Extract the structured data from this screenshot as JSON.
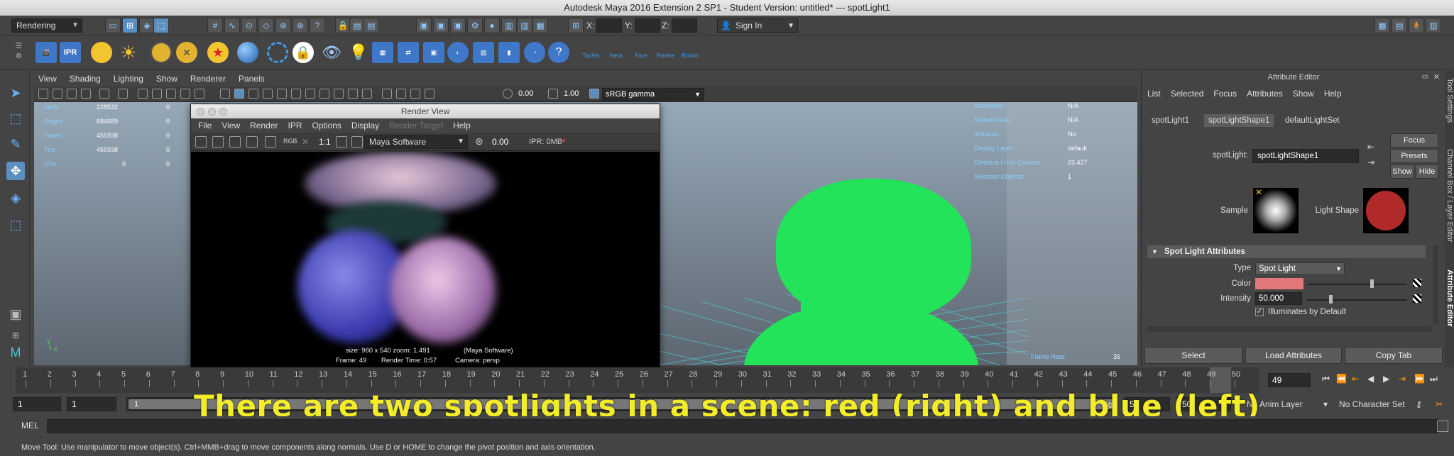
{
  "window": {
    "title": "Autodesk Maya 2016 Extension 2 SP1 - Student Version: untitled*   ---   spotLight1"
  },
  "status_line": {
    "menuset": "Rendering",
    "x_label": "X:",
    "y_label": "Y:",
    "z_label": "Z:",
    "sign_in": "Sign In"
  },
  "shelf": {
    "ipr_label": "IPR",
    "rig_labels": [
      "TopHe:",
      "Neck",
      "Face",
      "Forehe",
      "Botton"
    ]
  },
  "viewport": {
    "menus": [
      "View",
      "Shading",
      "Lighting",
      "Show",
      "Renderer",
      "Panels"
    ],
    "exposure": "0.00",
    "gamma": "1.00",
    "color_space": "sRGB gamma",
    "hud_left": [
      {
        "label": "Verts:",
        "a": "228532",
        "b": "0"
      },
      {
        "label": "Edges:",
        "a": "684689",
        "b": "0"
      },
      {
        "label": "Faces:",
        "a": "455938",
        "b": "0"
      },
      {
        "label": "Tris:",
        "a": "455938",
        "b": "0"
      },
      {
        "label": "UVs:",
        "a": "0",
        "b": "0"
      }
    ],
    "hud_right": [
      {
        "label": "Backfaces:",
        "value": "N/A"
      },
      {
        "label": "Smoothness:",
        "value": "N/A"
      },
      {
        "label": "Instance:",
        "value": "No"
      },
      {
        "label": "Display Layer:",
        "value": "default"
      },
      {
        "label": "Distance From Camera:",
        "value": "23.427"
      },
      {
        "label": "Selected Objects:",
        "value": "1"
      }
    ],
    "frame_rate_label": "Frame Rate:",
    "frame_rate_value": "35"
  },
  "render_view": {
    "title": "Render View",
    "menus": [
      "File",
      "View",
      "Render",
      "IPR",
      "Options",
      "Display",
      "Render Target",
      "Help"
    ],
    "rgb_label": "RGB",
    "ratio_label": "1:1",
    "renderer": "Maya Software",
    "exposure": "0.00",
    "ipr_mem": "IPR: 0MB",
    "info_size": "size: 960 x 540  zoom: 1.491",
    "info_renderer": "(Maya Software)",
    "info_frame": "Frame: 49",
    "info_time": "Render Time: 0:57",
    "info_camera": "Camera: persp"
  },
  "attribute_editor": {
    "title": "Attribute Editor",
    "menus": [
      "List",
      "Selected",
      "Focus",
      "Attributes",
      "Show",
      "Help"
    ],
    "tabs": [
      "spotLight1",
      "spotLightShape1",
      "defaultLightSet"
    ],
    "focus_btn": "Focus",
    "presets_btn": "Presets",
    "show_btn": "Show",
    "hide_btn": "Hide",
    "node_label": "spotLight:",
    "node_value": "spotLightShape1",
    "sample_label": "Sample",
    "light_shape_label": "Light Shape",
    "section": "Spot Light Attributes",
    "type_label": "Type",
    "type_value": "Spot Light",
    "color_label": "Color",
    "intensity_label": "Intensity",
    "intensity_value": "50.000",
    "illum_label": "Illuminates by Default",
    "select_btn": "Select",
    "load_btn": "Load Attributes",
    "copy_btn": "Copy Tab"
  },
  "side_tabs": [
    "Tool Settings",
    "Channel Box / Layer Editor",
    "Attribute Editor"
  ],
  "timeline": {
    "ticks": [
      "1",
      "2",
      "3",
      "4",
      "5",
      "6",
      "7",
      "8",
      "9",
      "10",
      "11",
      "12",
      "13",
      "14",
      "15",
      "16",
      "17",
      "18",
      "19",
      "20",
      "21",
      "22",
      "23",
      "24",
      "25",
      "26",
      "27",
      "28",
      "29",
      "30",
      "31",
      "32",
      "33",
      "34",
      "35",
      "36",
      "37",
      "38",
      "39",
      "40",
      "41",
      "42",
      "43",
      "44",
      "45",
      "46",
      "47",
      "48",
      "49",
      "50"
    ],
    "current": "49",
    "current_field": "49"
  },
  "range": {
    "start": "1",
    "start2": "1",
    "inner_start": "1",
    "inner_end": "50",
    "end1": "50",
    "end2": "50",
    "anim_layer": "No Anim Layer",
    "char_set": "No Character Set"
  },
  "command": {
    "mel_label": "MEL"
  },
  "help_line": "Move Tool: Use manipulator to move object(s). Ctrl+MMB+drag to move components along normals. Use D or HOME to change the pivot position and axis orientation.",
  "subtitle": "There are two spotlights in a scene: red (right) and blue (left)",
  "colors": {
    "accent": "#5b8fbf",
    "subtitle": "#f2ec2a",
    "green_object": "#22e35a",
    "light_shape": "#b12a2a",
    "light_color": "#e2777a"
  }
}
